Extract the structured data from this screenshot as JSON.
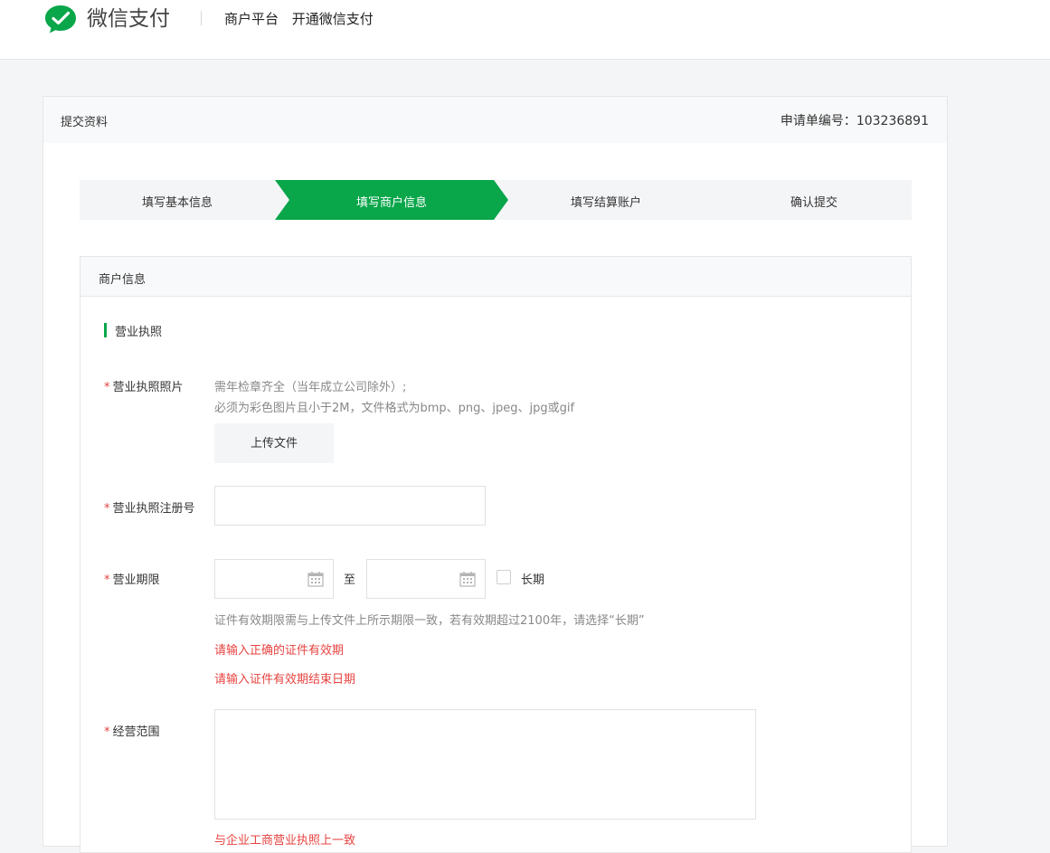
{
  "header": {
    "brand": "微信支付",
    "nav": [
      "商户平台",
      "开通微信支付"
    ]
  },
  "card": {
    "title": "提交资料",
    "application_number_label": "申请单编号：103236891"
  },
  "steps": [
    {
      "label": "填写基本信息",
      "active": false
    },
    {
      "label": "填写商户信息",
      "active": true
    },
    {
      "label": "填写结算账户",
      "active": false
    },
    {
      "label": "确认提交",
      "active": false
    }
  ],
  "section": {
    "title": "商户信息",
    "subsection_title": "营业执照",
    "fields": {
      "license_photo": {
        "label": "营业执照照片",
        "hint_line1": "需年检章齐全（当年成立公司除外）;",
        "hint_line2": "必须为彩色图片且小于2M，文件格式为bmp、png、jpeg、jpg或gif",
        "upload_button": "上传文件"
      },
      "license_number": {
        "label": "营业执照注册号",
        "value": ""
      },
      "business_term": {
        "label": "营业期限",
        "start_value": "",
        "to_label": "至",
        "end_value": "",
        "long_term_label": "长期",
        "long_term_checked": false,
        "hint": "证件有效期限需与上传文件上所示期限一致，若有效期超过2100年，请选择“长期”",
        "error1": "请输入正确的证件有效期",
        "error2": "请输入证件有效期结束日期"
      },
      "business_scope": {
        "label": "经营范围",
        "value": "",
        "hint_partial": "与企业工商营业执照上一致"
      }
    }
  },
  "colors": {
    "brand_green": "#09a64a",
    "error_red": "#e64340",
    "step_background": "#f4f5f7"
  }
}
